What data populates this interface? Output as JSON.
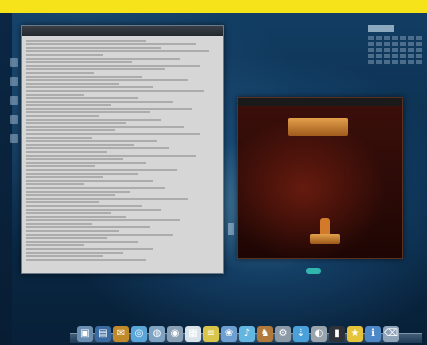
{
  "colors": {
    "top_bar": "#f7e31a",
    "terminal_background": "#d6d6d6",
    "movie_background": "#2a0c08"
  },
  "dock": {
    "items": [
      {
        "icon": "finder-icon",
        "color": "#6b8fb3",
        "glyph": "▣"
      },
      {
        "icon": "folder-icon",
        "color": "#3a6aa0",
        "glyph": "▤"
      },
      {
        "icon": "mail-icon",
        "color": "#c08a2a",
        "glyph": "✉"
      },
      {
        "icon": "browser-icon",
        "color": "#5aa6d8",
        "glyph": "◎"
      },
      {
        "icon": "chat-icon",
        "color": "#7fa3c2",
        "glyph": "◍"
      },
      {
        "icon": "camera-icon",
        "color": "#8aa0b5",
        "glyph": "◉"
      },
      {
        "icon": "calendar-icon",
        "color": "#d9e3ea",
        "glyph": "▦"
      },
      {
        "icon": "notes-icon",
        "color": "#d8c54a",
        "glyph": "≡"
      },
      {
        "icon": "photos-icon",
        "color": "#6e9fd1",
        "glyph": "❀"
      },
      {
        "icon": "music-icon",
        "color": "#63b6e0",
        "glyph": "♪"
      },
      {
        "icon": "game-icon",
        "color": "#b07a3c",
        "glyph": "♞"
      },
      {
        "icon": "settings-icon",
        "color": "#8c9aa8",
        "glyph": "⚙"
      },
      {
        "icon": "download-icon",
        "color": "#4aa0d9",
        "glyph": "⇣"
      },
      {
        "icon": "disk-icon",
        "color": "#9aa4ad",
        "glyph": "◐"
      },
      {
        "icon": "terminal-icon",
        "color": "#2d3238",
        "glyph": "▮"
      },
      {
        "icon": "star-icon",
        "color": "#e6c43a",
        "glyph": "★"
      },
      {
        "icon": "info-icon",
        "color": "#4d88c8",
        "glyph": "ℹ"
      },
      {
        "icon": "trash-icon",
        "color": "#8fa4b8",
        "glyph": "⌫"
      }
    ]
  }
}
